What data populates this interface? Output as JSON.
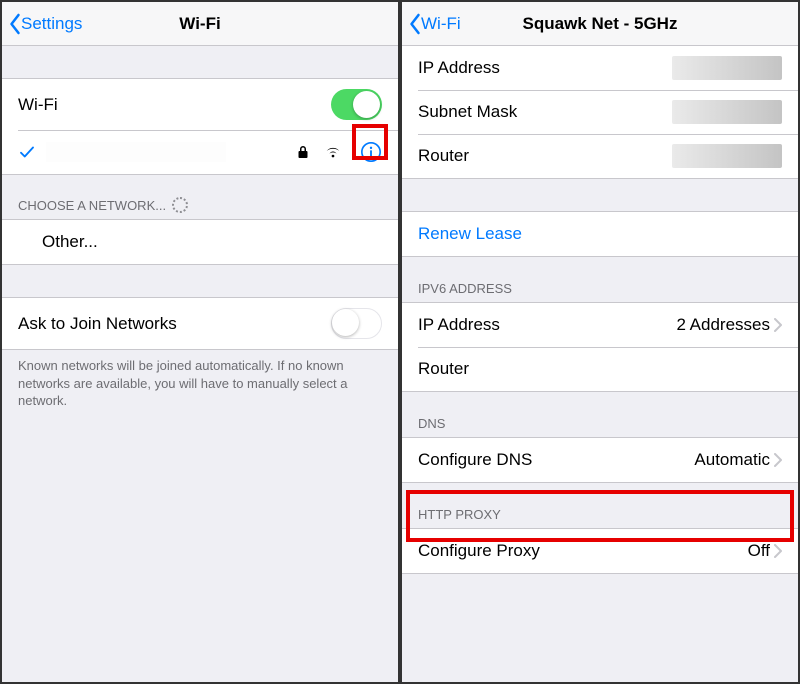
{
  "left": {
    "back_label": "Settings",
    "title": "Wi-Fi",
    "wifi_label": "Wi-Fi",
    "choose_header": "CHOOSE A NETWORK...",
    "other_label": "Other...",
    "ask_label": "Ask to Join Networks",
    "ask_footer": "Known networks will be joined automatically. If no known networks are available, you will have to manually select a network."
  },
  "right": {
    "back_label": "Wi-Fi",
    "title": "Squawk Net - 5GHz",
    "ipv4": {
      "ip_label": "IP Address",
      "subnet_label": "Subnet Mask",
      "router_label": "Router"
    },
    "renew_label": "Renew Lease",
    "ipv6_header": "IPV6 ADDRESS",
    "ipv6": {
      "ip_label": "IP Address",
      "ip_value": "2 Addresses",
      "router_label": "Router"
    },
    "dns_header": "DNS",
    "dns_label": "Configure DNS",
    "dns_value": "Automatic",
    "proxy_header": "HTTP PROXY",
    "proxy_label": "Configure Proxy",
    "proxy_value": "Off"
  }
}
